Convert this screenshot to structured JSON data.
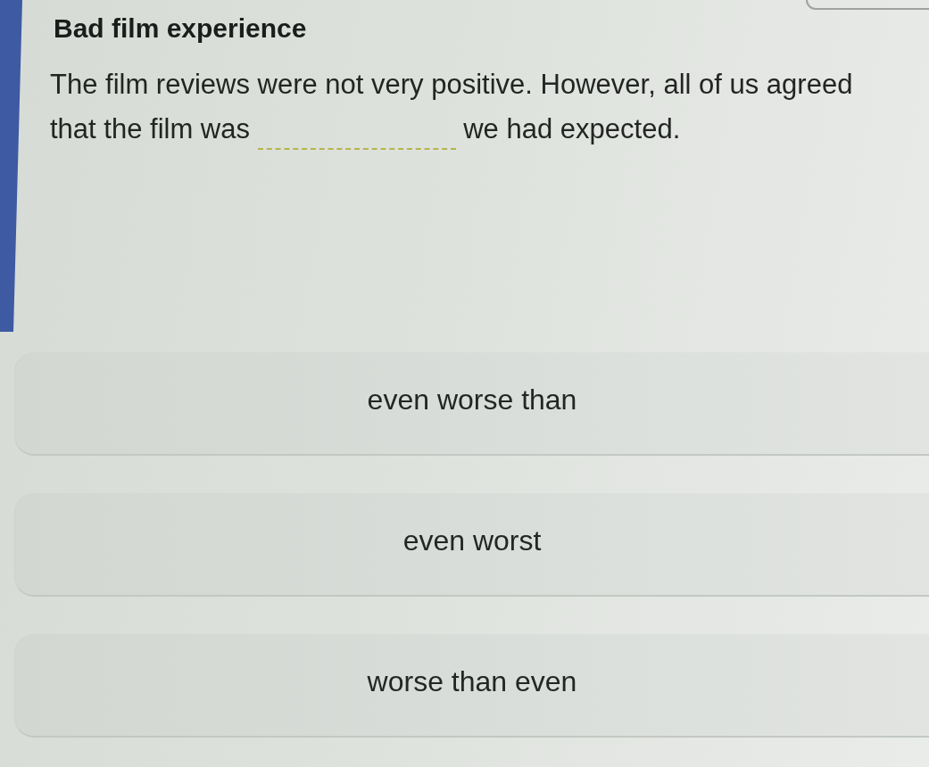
{
  "header": {
    "title": "Bad film experience"
  },
  "question": {
    "parts": [
      {
        "kind": "text",
        "text": "The film reviews were not very positive. However, all of us agreed that the film was"
      },
      {
        "kind": "blank"
      },
      {
        "kind": "text",
        "text": "we had expected."
      }
    ]
  },
  "options": [
    {
      "label": "even worse than",
      "selected": false
    },
    {
      "label": "even worst",
      "selected": false
    },
    {
      "label": "worse than even",
      "selected": false
    }
  ]
}
